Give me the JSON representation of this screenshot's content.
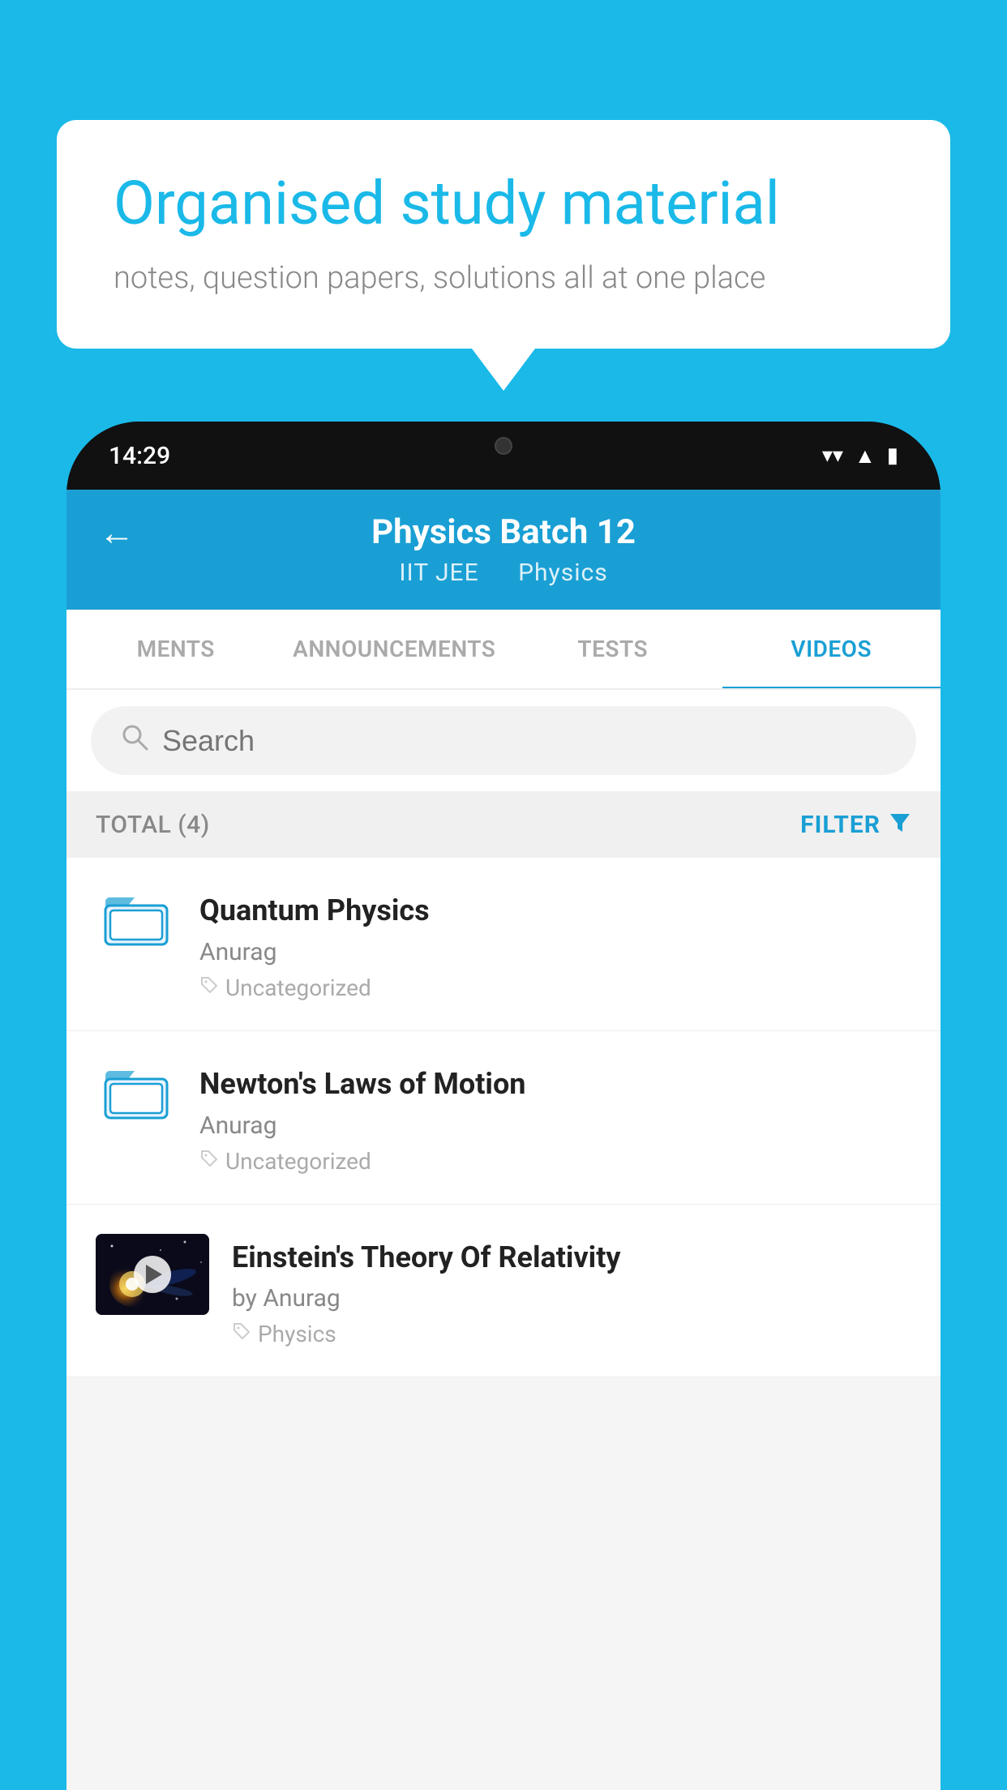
{
  "background": {
    "color": "#1ab9e8"
  },
  "speech_bubble": {
    "title": "Organised study material",
    "subtitle": "notes, question papers, solutions all at one place"
  },
  "phone": {
    "time": "14:29",
    "header": {
      "title": "Physics Batch 12",
      "subtitle1": "IIT JEE",
      "subtitle2": "Physics"
    },
    "tabs": [
      {
        "label": "MENTS",
        "active": false
      },
      {
        "label": "ANNOUNCEMENTS",
        "active": false
      },
      {
        "label": "TESTS",
        "active": false
      },
      {
        "label": "VIDEOS",
        "active": true
      }
    ],
    "search": {
      "placeholder": "Search"
    },
    "filter": {
      "total_label": "TOTAL (4)",
      "filter_label": "FILTER"
    },
    "videos": [
      {
        "id": 1,
        "title": "Quantum Physics",
        "author": "Anurag",
        "tag": "Uncategorized",
        "has_thumbnail": false
      },
      {
        "id": 2,
        "title": "Newton's Laws of Motion",
        "author": "Anurag",
        "tag": "Uncategorized",
        "has_thumbnail": false
      },
      {
        "id": 3,
        "title": "Einstein's Theory Of Relativity",
        "author": "by Anurag",
        "tag": "Physics",
        "has_thumbnail": true
      }
    ]
  }
}
